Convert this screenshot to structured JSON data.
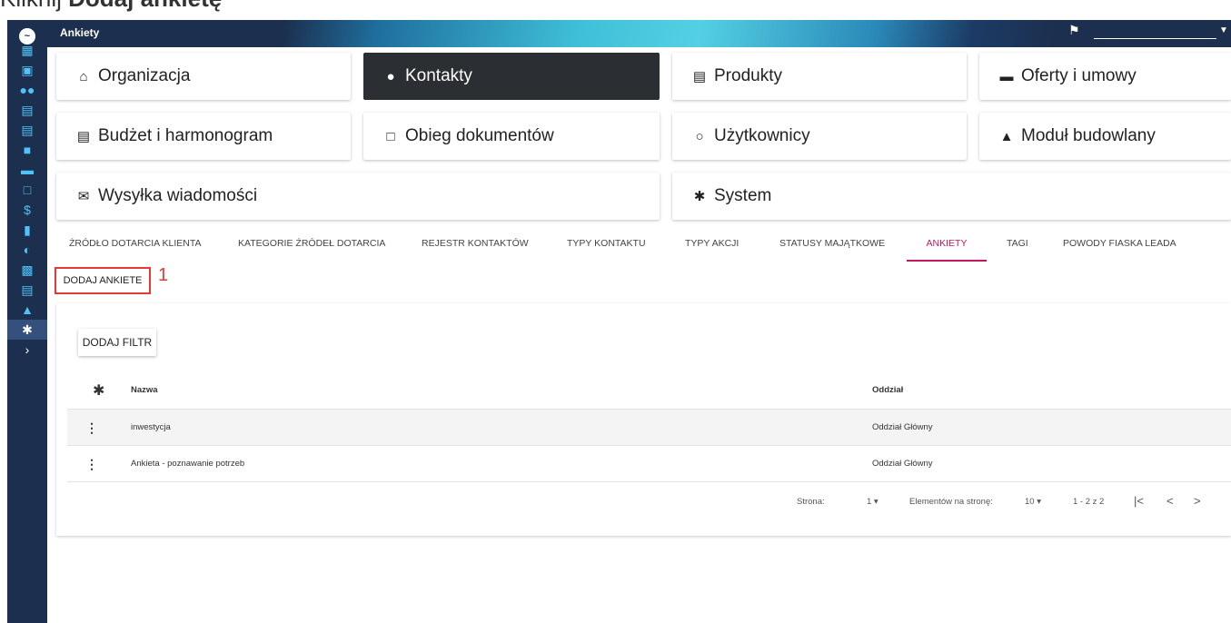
{
  "caption": {
    "prefix": "Kliknij ",
    "bold": "Dodaj ankietę"
  },
  "app": {
    "title": "Ankiety"
  },
  "sidebar": {
    "icons": [
      "dashboard-icon",
      "calendar-icon",
      "people-icon",
      "building-icon",
      "store-icon",
      "briefcase-icon",
      "folder-icon",
      "inbox-icon",
      "dollar-icon",
      "document-icon",
      "pie-chart-icon",
      "bar-chart-icon",
      "card-icon",
      "warning-icon",
      "gear-icon",
      "chevron-right-icon"
    ],
    "active": "gear-icon"
  },
  "modules": [
    {
      "label": "Organizacja",
      "icon": "home-icon"
    },
    {
      "label": "Kontakty",
      "icon": "person-icon",
      "active": true
    },
    {
      "label": "Produkty",
      "icon": "store-icon"
    },
    {
      "label": "Oferty i umowy",
      "icon": "folder-icon"
    },
    {
      "label": "Budżet i harmonogram",
      "icon": "building-icon"
    },
    {
      "label": "Obieg dokumentów",
      "icon": "inbox-icon"
    },
    {
      "label": "Użytkownicy",
      "icon": "user-outline-icon"
    },
    {
      "label": "Moduł budowlany",
      "icon": "warning-icon"
    },
    {
      "label": "Wysyłka wiadomości",
      "icon": "mail-icon"
    },
    {
      "label": "System",
      "icon": "gear-icon"
    }
  ],
  "tabs": [
    "ŹRÓDŁO DOTARCIA KLIENTA",
    "KATEGORIE ŹRÓDEŁ DOTARCIA",
    "REJESTR KONTAKTÓW",
    "TYPY KONTAKTU",
    "TYPY AKCJI",
    "STATUSY MAJĄTKOWE",
    "ANKIETY",
    "TAGI",
    "POWODY FIASKA LEADA"
  ],
  "active_tab": "ANKIETY",
  "actions": {
    "add_survey": "DODAJ ANKIETE",
    "step_marker": "1",
    "add_filter": "DODAJ FILTR"
  },
  "table": {
    "columns": {
      "name": "Nazwa",
      "branch": "Oddział"
    },
    "rows": [
      {
        "name": "inwestycja",
        "branch": "Oddział Główny"
      },
      {
        "name": "Ankieta - poznawanie potrzeb",
        "branch": "Oddział Główny"
      }
    ]
  },
  "pagination": {
    "page_label": "Strona:",
    "page": "1",
    "per_page_label": "Elementów na stronę:",
    "per_page": "10",
    "range": "1 - 2 z 2"
  },
  "colors": {
    "sidebar": "#1c2f4f",
    "accent": "#4fc3f7",
    "active_tab": "#c2185b",
    "highlight": "#e53935",
    "active_tile": "#2b2f33"
  }
}
